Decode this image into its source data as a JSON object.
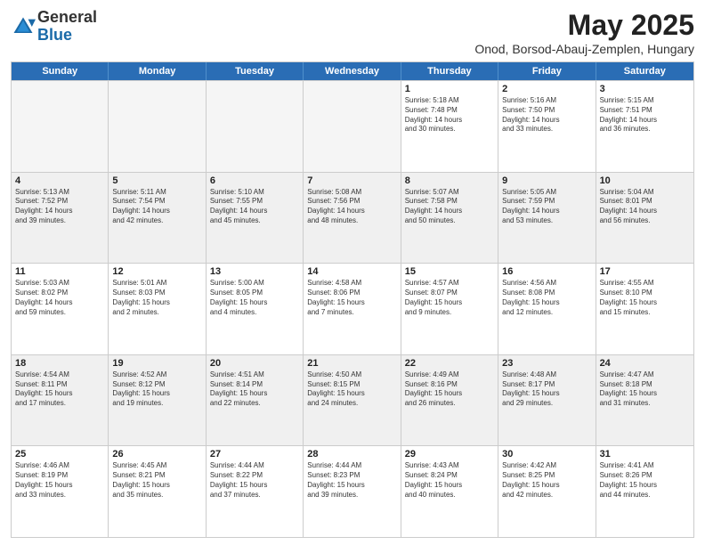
{
  "header": {
    "logo_general": "General",
    "logo_blue": "Blue",
    "month_title": "May 2025",
    "location": "Onod, Borsod-Abauj-Zemplen, Hungary"
  },
  "weekdays": [
    "Sunday",
    "Monday",
    "Tuesday",
    "Wednesday",
    "Thursday",
    "Friday",
    "Saturday"
  ],
  "rows": [
    [
      {
        "day": "",
        "info": "",
        "empty": true
      },
      {
        "day": "",
        "info": "",
        "empty": true
      },
      {
        "day": "",
        "info": "",
        "empty": true
      },
      {
        "day": "",
        "info": "",
        "empty": true
      },
      {
        "day": "1",
        "info": "Sunrise: 5:18 AM\nSunset: 7:48 PM\nDaylight: 14 hours\nand 30 minutes."
      },
      {
        "day": "2",
        "info": "Sunrise: 5:16 AM\nSunset: 7:50 PM\nDaylight: 14 hours\nand 33 minutes."
      },
      {
        "day": "3",
        "info": "Sunrise: 5:15 AM\nSunset: 7:51 PM\nDaylight: 14 hours\nand 36 minutes."
      }
    ],
    [
      {
        "day": "4",
        "info": "Sunrise: 5:13 AM\nSunset: 7:52 PM\nDaylight: 14 hours\nand 39 minutes."
      },
      {
        "day": "5",
        "info": "Sunrise: 5:11 AM\nSunset: 7:54 PM\nDaylight: 14 hours\nand 42 minutes."
      },
      {
        "day": "6",
        "info": "Sunrise: 5:10 AM\nSunset: 7:55 PM\nDaylight: 14 hours\nand 45 minutes."
      },
      {
        "day": "7",
        "info": "Sunrise: 5:08 AM\nSunset: 7:56 PM\nDaylight: 14 hours\nand 48 minutes."
      },
      {
        "day": "8",
        "info": "Sunrise: 5:07 AM\nSunset: 7:58 PM\nDaylight: 14 hours\nand 50 minutes."
      },
      {
        "day": "9",
        "info": "Sunrise: 5:05 AM\nSunset: 7:59 PM\nDaylight: 14 hours\nand 53 minutes."
      },
      {
        "day": "10",
        "info": "Sunrise: 5:04 AM\nSunset: 8:01 PM\nDaylight: 14 hours\nand 56 minutes."
      }
    ],
    [
      {
        "day": "11",
        "info": "Sunrise: 5:03 AM\nSunset: 8:02 PM\nDaylight: 14 hours\nand 59 minutes."
      },
      {
        "day": "12",
        "info": "Sunrise: 5:01 AM\nSunset: 8:03 PM\nDaylight: 15 hours\nand 2 minutes."
      },
      {
        "day": "13",
        "info": "Sunrise: 5:00 AM\nSunset: 8:05 PM\nDaylight: 15 hours\nand 4 minutes."
      },
      {
        "day": "14",
        "info": "Sunrise: 4:58 AM\nSunset: 8:06 PM\nDaylight: 15 hours\nand 7 minutes."
      },
      {
        "day": "15",
        "info": "Sunrise: 4:57 AM\nSunset: 8:07 PM\nDaylight: 15 hours\nand 9 minutes."
      },
      {
        "day": "16",
        "info": "Sunrise: 4:56 AM\nSunset: 8:08 PM\nDaylight: 15 hours\nand 12 minutes."
      },
      {
        "day": "17",
        "info": "Sunrise: 4:55 AM\nSunset: 8:10 PM\nDaylight: 15 hours\nand 15 minutes."
      }
    ],
    [
      {
        "day": "18",
        "info": "Sunrise: 4:54 AM\nSunset: 8:11 PM\nDaylight: 15 hours\nand 17 minutes."
      },
      {
        "day": "19",
        "info": "Sunrise: 4:52 AM\nSunset: 8:12 PM\nDaylight: 15 hours\nand 19 minutes."
      },
      {
        "day": "20",
        "info": "Sunrise: 4:51 AM\nSunset: 8:14 PM\nDaylight: 15 hours\nand 22 minutes."
      },
      {
        "day": "21",
        "info": "Sunrise: 4:50 AM\nSunset: 8:15 PM\nDaylight: 15 hours\nand 24 minutes."
      },
      {
        "day": "22",
        "info": "Sunrise: 4:49 AM\nSunset: 8:16 PM\nDaylight: 15 hours\nand 26 minutes."
      },
      {
        "day": "23",
        "info": "Sunrise: 4:48 AM\nSunset: 8:17 PM\nDaylight: 15 hours\nand 29 minutes."
      },
      {
        "day": "24",
        "info": "Sunrise: 4:47 AM\nSunset: 8:18 PM\nDaylight: 15 hours\nand 31 minutes."
      }
    ],
    [
      {
        "day": "25",
        "info": "Sunrise: 4:46 AM\nSunset: 8:19 PM\nDaylight: 15 hours\nand 33 minutes."
      },
      {
        "day": "26",
        "info": "Sunrise: 4:45 AM\nSunset: 8:21 PM\nDaylight: 15 hours\nand 35 minutes."
      },
      {
        "day": "27",
        "info": "Sunrise: 4:44 AM\nSunset: 8:22 PM\nDaylight: 15 hours\nand 37 minutes."
      },
      {
        "day": "28",
        "info": "Sunrise: 4:44 AM\nSunset: 8:23 PM\nDaylight: 15 hours\nand 39 minutes."
      },
      {
        "day": "29",
        "info": "Sunrise: 4:43 AM\nSunset: 8:24 PM\nDaylight: 15 hours\nand 40 minutes."
      },
      {
        "day": "30",
        "info": "Sunrise: 4:42 AM\nSunset: 8:25 PM\nDaylight: 15 hours\nand 42 minutes."
      },
      {
        "day": "31",
        "info": "Sunrise: 4:41 AM\nSunset: 8:26 PM\nDaylight: 15 hours\nand 44 minutes."
      }
    ]
  ]
}
